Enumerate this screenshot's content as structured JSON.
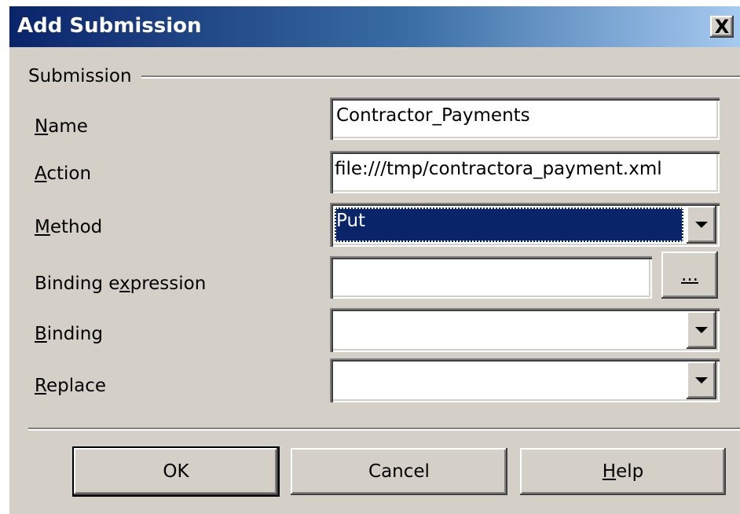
{
  "dialog": {
    "title": "Add Submission",
    "close_label": "X"
  },
  "group": {
    "label": "Submission"
  },
  "fields": {
    "name": {
      "label_mnemonic": "N",
      "label_rest": "ame",
      "value": "Contractor_Payments"
    },
    "action": {
      "label_mnemonic": "A",
      "label_rest": "ction",
      "value": "file:///tmp/contractora_payment.xml"
    },
    "method": {
      "label_mnemonic": "M",
      "label_rest": "ethod",
      "value": "Put"
    },
    "binding_expression": {
      "label_pre": "Binding e",
      "label_mnemonic": "x",
      "label_rest": "pression",
      "value": "",
      "browse_label": "..."
    },
    "binding": {
      "label_mnemonic": "B",
      "label_rest": "inding",
      "value": ""
    },
    "replace": {
      "label_mnemonic": "R",
      "label_rest": "eplace",
      "value": ""
    }
  },
  "buttons": {
    "ok": "OK",
    "cancel": "Cancel",
    "help_mnemonic": "H",
    "help_rest": "elp"
  },
  "icons": {
    "close": "close-icon",
    "dropdown": "chevron-down-icon"
  },
  "colors": {
    "title_start": "#0a246a",
    "title_end": "#a6caf0",
    "face": "#d4d0c8",
    "selection": "#0a246a"
  }
}
